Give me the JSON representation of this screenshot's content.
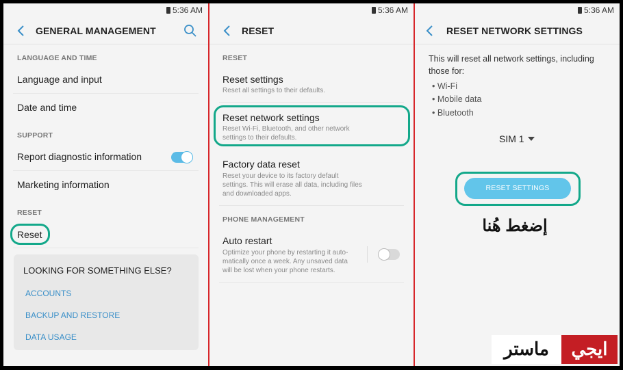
{
  "status": {
    "time": "5:36 AM"
  },
  "panel1": {
    "title": "GENERAL MANAGEMENT",
    "section_language": "LANGUAGE AND TIME",
    "item_language": "Language and input",
    "item_datetime": "Date and time",
    "section_support": "SUPPORT",
    "item_report": "Report diagnostic information",
    "report_toggle_on": true,
    "item_marketing": "Marketing information",
    "section_reset": "RESET",
    "item_reset": "Reset",
    "card": {
      "title": "LOOKING FOR SOMETHING ELSE?",
      "links": [
        "ACCOUNTS",
        "BACKUP AND RESTORE",
        "DATA USAGE"
      ]
    }
  },
  "panel2": {
    "title": "RESET",
    "section_reset": "RESET",
    "reset_settings": {
      "label": "Reset settings",
      "desc": "Reset all settings to their defaults."
    },
    "reset_network": {
      "label": "Reset network settings",
      "desc1": "Reset Wi-Fi, Bluetooth, and other network",
      "desc2": "settings to their defaults."
    },
    "factory": {
      "label": "Factory data reset",
      "desc1": "Reset your device to its factory default",
      "desc2": "settings. This will erase all data, including files",
      "desc3": "and downloaded apps."
    },
    "section_phone": "PHONE MANAGEMENT",
    "auto_restart": {
      "label": "Auto restart",
      "desc1": "Optimize your phone by restarting it auto-",
      "desc2": "matically once a week. Any unsaved data",
      "desc3": "will be lost when your phone restarts.",
      "toggle_on": false
    }
  },
  "panel3": {
    "title": "RESET NETWORK SETTINGS",
    "intro": "This will reset all network settings, including those for:",
    "bullets": [
      "• Wi-Fi",
      "• Mobile data",
      "• Bluetooth"
    ],
    "sim": "SIM 1",
    "button": "RESET SETTINGS",
    "tap_here": "إضغط هُنا"
  },
  "logo": {
    "part_red": "ايجي",
    "part_black": "ماستر"
  },
  "colors": {
    "accent_green": "#13a88a",
    "toggle_on": "#5bbbe6",
    "link_blue": "#3a8fc8",
    "divider_red": "#d7262a",
    "button_blue": "#62c5ea"
  }
}
